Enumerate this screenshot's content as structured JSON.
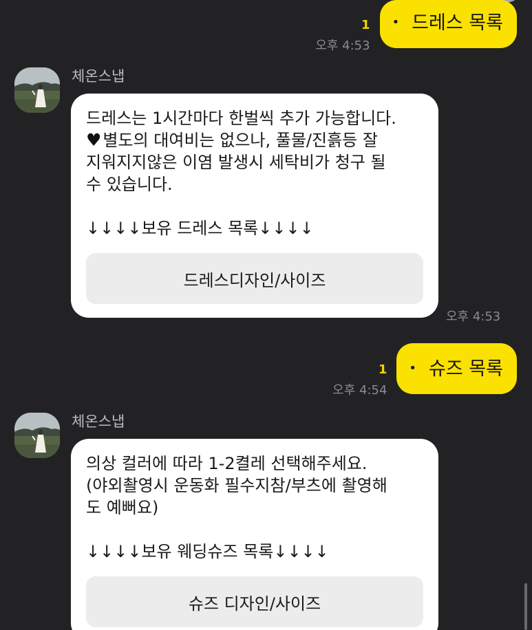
{
  "colors": {
    "background": "#222224",
    "outgoing_bubble": "#fae100",
    "incoming_bubble": "#ffffff",
    "unread": "#f2d400",
    "timestamp": "#8b8b8f",
    "link_button": "#ececec"
  },
  "messages": [
    {
      "direction": "outgoing",
      "bullet": "•",
      "text": "드레스 목록",
      "unread": "1",
      "time": "오후 4:53"
    },
    {
      "direction": "incoming",
      "sender": "체온스냅",
      "avatar_icon": "profile-photo-icon",
      "lines": [
        "드레스는 1시간마다 한벌씩 추가 가능합니다.",
        "별도의 대여비는 없으나, 풀물/진흙등 잘",
        "지워지지않은 이염 발생시 세탁비가 청구 될",
        "수 있습니다.",
        "",
        "↓↓↓↓보유 드레스 목록↓↓↓↓"
      ],
      "heart_icon": "black-heart-icon",
      "button_label": "드레스디자인/사이즈",
      "time": "오후 4:53"
    },
    {
      "direction": "outgoing",
      "bullet": "•",
      "text": "슈즈 목록",
      "unread": "1",
      "time": "오후 4:54"
    },
    {
      "direction": "incoming",
      "sender": "체온스냅",
      "avatar_icon": "profile-photo-icon",
      "lines": [
        "의상 컬러에 따라 1-2켤레 선택해주세요.",
        "(야외촬영시 운동화 필수지참/부츠에 촬영해",
        "도 예뻐요)",
        "",
        "↓↓↓↓보유 웨딩슈즈 목록↓↓↓↓"
      ],
      "button_label": "슈즈 디자인/사이즈"
    }
  ]
}
